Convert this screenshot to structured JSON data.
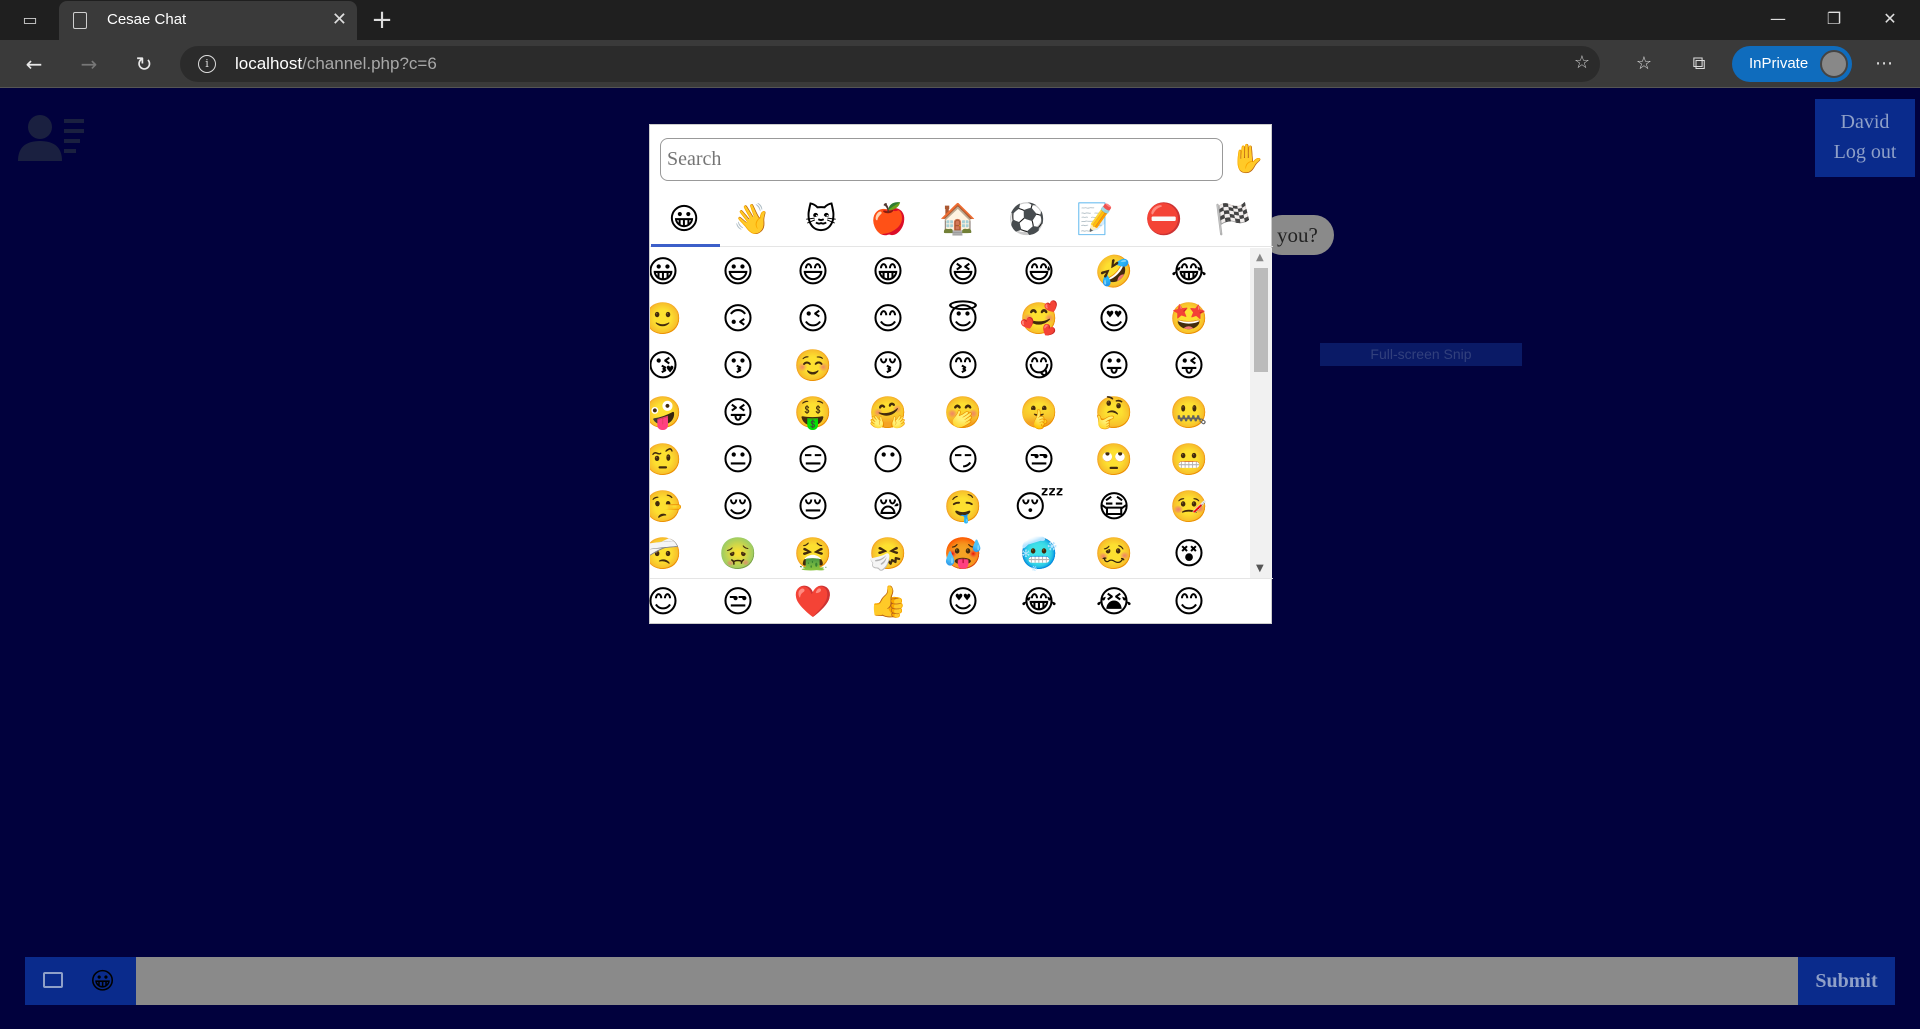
{
  "browser": {
    "tab_title": "Cesae Chat",
    "url_host": "localhost",
    "url_path": "/channel.php?c=6",
    "inprivate_label": "InPrivate"
  },
  "page": {
    "user": {
      "name": "David",
      "logout_label": "Log out"
    },
    "bubble_text": "you?",
    "snip_text": "Full-screen Snip"
  },
  "emoji_picker": {
    "search_placeholder": "Search",
    "skin_tone": "✋",
    "categories": [
      "😀",
      "👋",
      "🐱",
      "🍎",
      "🏠",
      "⚽",
      "📝",
      "⛔",
      "🏁"
    ],
    "grid": [
      [
        "😀",
        "😃",
        "😄",
        "😁",
        "😆",
        "😅",
        "🤣",
        "😂"
      ],
      [
        "🙂",
        "🙃",
        "😉",
        "😊",
        "😇",
        "🥰",
        "😍",
        "🤩"
      ],
      [
        "😘",
        "😗",
        "☺️",
        "😚",
        "😙",
        "😋",
        "😛",
        "😜"
      ],
      [
        "🤪",
        "😝",
        "🤑",
        "🤗",
        "🤭",
        "🤫",
        "🤔",
        "🤐"
      ],
      [
        "🤨",
        "😐",
        "😑",
        "😶",
        "😏",
        "😒",
        "🙄",
        "😬"
      ],
      [
        "🤥",
        "😌",
        "😔",
        "😪",
        "🤤",
        "😴",
        "😷",
        "🤒"
      ],
      [
        "🤕",
        "🤢",
        "🤮",
        "🤧",
        "🥵",
        "🥶",
        "🥴",
        "😵"
      ]
    ],
    "recent": [
      "😊",
      "😒",
      "❤️",
      "👍",
      "😍",
      "😂",
      "😭",
      "😊"
    ]
  },
  "composer": {
    "emoji_button": "😀",
    "submit_label": "Submit"
  },
  "colors": {
    "page_bg": "#01013d",
    "accent": "#0a2b8c",
    "indicator": "#3c5fc9"
  }
}
